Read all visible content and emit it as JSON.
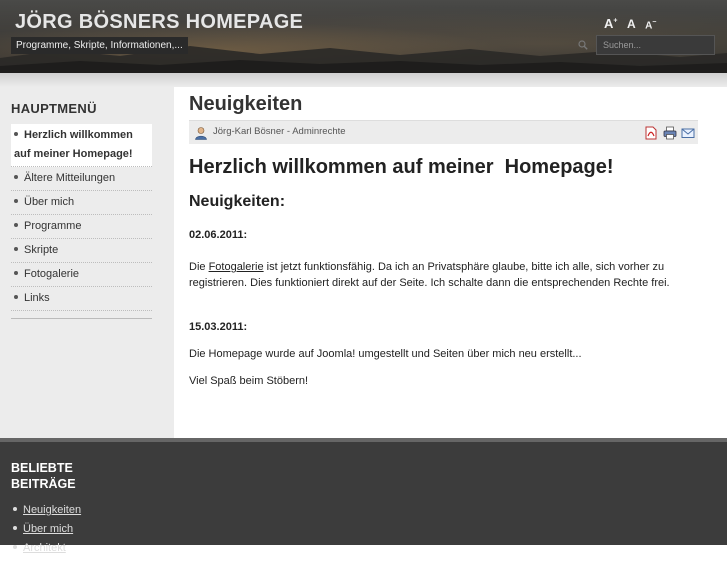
{
  "header": {
    "title": "JÖRG BÖSNERS HOMEPAGE",
    "subtitle": "Programme, Skripte, Informationen,...",
    "font_controls": [
      "A+",
      "A",
      "A-"
    ],
    "search_placeholder": "Suchen..."
  },
  "sidebar": {
    "heading": "HAUPTMENÜ",
    "items": [
      {
        "label": "Herzlich willkommen auf meiner Homepage!",
        "active": true
      },
      {
        "label": "Ältere Mitteilungen"
      },
      {
        "label": "Über mich"
      },
      {
        "label": "Programme"
      },
      {
        "label": "Skripte"
      },
      {
        "label": "Fotogalerie"
      },
      {
        "label": "Links"
      }
    ]
  },
  "content": {
    "page_title": "Neuigkeiten",
    "author": "Jörg-Karl Bösner - Adminrechte",
    "tools": [
      "pdf-icon",
      "print-icon",
      "email-icon"
    ],
    "article_title": "Herzlich willkommen auf meiner  Homepage!",
    "subheading": "Neuigkeiten:",
    "entry1_date": "02.06.2011:",
    "entry1_pre": "Die ",
    "entry1_link": "Fotogalerie",
    "entry1_post": " ist jetzt funktionsfähig. Da ich an Privatsphäre glaube, bitte ich alle, sich vorher zu registrieren. Dies funktioniert direkt auf der Seite. Ich schalte dann die entsprechenden Rechte frei.",
    "entry2_date": "15.03.2011:",
    "entry2_text": "Die Homepage wurde auf Joomla! umgestellt und Seiten über mich neu erstellt...",
    "closing": "Viel Spaß beim Stöbern!"
  },
  "footer": {
    "heading_line1": "BELIEBTE",
    "heading_line2": "BEITRÄGE",
    "popular": [
      "Neuigkeiten",
      "Über mich",
      "Architekt"
    ]
  }
}
